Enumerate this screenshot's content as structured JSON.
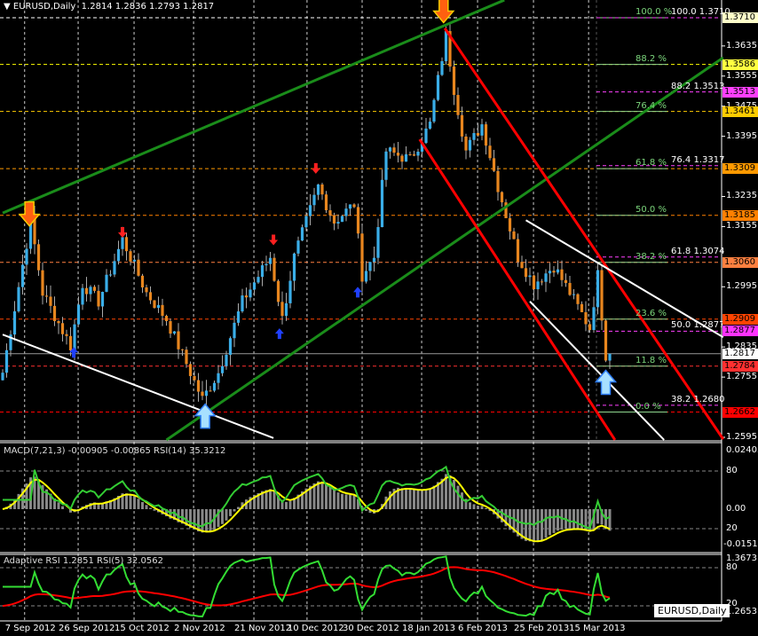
{
  "header": {
    "symbol": "EURUSD,Daily",
    "ohlc": "1.2814 1.2836 1.2793 1.2817"
  },
  "macd_header": "MACD(7,21,3) -0.00905 -0.00865  RSI(14) 35.3212",
  "arsi_header": "Adaptive RSI 1.2851  RSI(5) 32.0562",
  "symbol_badge": "EURUSD,Daily",
  "colors": {
    "bull": "#3aaee8",
    "bear": "#e8861e",
    "channel": "#1a8c1a",
    "red": "#ff0000",
    "white": "#ffffff"
  },
  "chart_data": {
    "type": "candlestick",
    "price_range": [
      1.2595,
      1.371
    ],
    "bar_count": 153,
    "close_anchors": [
      [
        0,
        1.2767
      ],
      [
        7,
        1.3168
      ],
      [
        10,
        1.2979
      ],
      [
        17,
        1.2838
      ],
      [
        20,
        1.3003
      ],
      [
        24,
        1.2956
      ],
      [
        30,
        1.3121
      ],
      [
        36,
        1.2979
      ],
      [
        41,
        1.2909
      ],
      [
        44,
        1.2838
      ],
      [
        50,
        1.2696
      ],
      [
        54,
        1.2767
      ],
      [
        60,
        1.2956
      ],
      [
        67,
        1.3074
      ],
      [
        70,
        1.2909
      ],
      [
        73,
        1.3074
      ],
      [
        79,
        1.3262
      ],
      [
        83,
        1.3168
      ],
      [
        88,
        1.3215
      ],
      [
        90,
        1.3026
      ],
      [
        93,
        1.3074
      ],
      [
        96,
        1.3356
      ],
      [
        102,
        1.3333
      ],
      [
        107,
        1.3427
      ],
      [
        111,
        1.3663
      ],
      [
        113,
        1.3521
      ],
      [
        116,
        1.3356
      ],
      [
        120,
        1.3427
      ],
      [
        124,
        1.3262
      ],
      [
        129,
        1.3074
      ],
      [
        133,
        1.3003
      ],
      [
        138,
        1.305
      ],
      [
        142,
        1.2979
      ],
      [
        147,
        1.2885
      ],
      [
        149,
        1.3026
      ],
      [
        151,
        1.2814
      ],
      [
        152,
        1.2817
      ]
    ],
    "price_ticks": [
      "1.3635",
      "1.3555",
      "1.3475",
      "1.3395",
      "1.3235",
      "1.3155",
      "1.2995",
      "1.2835",
      "1.2755",
      "1.2595"
    ],
    "price_tags": [
      {
        "v": "1.3710",
        "p": 1.371,
        "c": "#ffffc8"
      },
      {
        "v": "1.3586",
        "p": 1.3586,
        "c": "#ffff40"
      },
      {
        "v": "1.3513",
        "p": 1.3513,
        "c": "#ff40ff"
      },
      {
        "v": "1.3461",
        "p": 1.3461,
        "c": "#ffcc00"
      },
      {
        "v": "1.3309",
        "p": 1.3309,
        "c": "#ff9900"
      },
      {
        "v": "1.3185",
        "p": 1.3185,
        "c": "#ff8000"
      },
      {
        "v": "1.3060",
        "p": 1.306,
        "c": "#ff8040"
      },
      {
        "v": "1.2909",
        "p": 1.2909,
        "c": "#ff4400"
      },
      {
        "v": "1.2877",
        "p": 1.2877,
        "c": "#ff33ff"
      },
      {
        "v": "1.2817",
        "p": 1.2817,
        "c": "#ffffff"
      },
      {
        "v": "1.2784",
        "p": 1.2784,
        "c": "#ff3030"
      },
      {
        "v": "1.2662",
        "p": 1.2662,
        "c": "#ff0000"
      }
    ],
    "fib_levels": [
      {
        "label": "100.0  %",
        "p": 1.371,
        "c": "#ffffff"
      },
      {
        "label": "88.2  %",
        "p": 1.3586,
        "c": "#ffff00"
      },
      {
        "label": "76.4  %",
        "p": 1.3461,
        "c": "#ffcc00"
      },
      {
        "label": "61.8  %",
        "p": 1.3309,
        "c": "#ff9900"
      },
      {
        "label": "50.0  %",
        "p": 1.3185,
        "c": "#ff8000"
      },
      {
        "label": "38.2  %",
        "p": 1.306,
        "c": "#ff8040"
      },
      {
        "label": "23.6  %",
        "p": 1.2909,
        "c": "#ff4400"
      },
      {
        "label": "11.8  %",
        "p": 1.2784,
        "c": "#ff3030"
      },
      {
        "label": "0.0  %",
        "p": 1.2662,
        "c": "#ff0000"
      }
    ],
    "fib2_levels": [
      {
        "label": "100.0  1.3710",
        "p": 1.371
      },
      {
        "label": "88.2  1.3513",
        "p": 1.3513
      },
      {
        "label": "76.4  1.3317",
        "p": 1.3317
      },
      {
        "label": "61.8  1.3074",
        "p": 1.3074
      },
      {
        "label": "50.0  1.2877",
        "p": 1.2877
      },
      {
        "label": "38.2  1.2680",
        "p": 1.268
      }
    ],
    "trendlines": [
      {
        "name": "green-channel-upper",
        "c": "#1a8c1a",
        "pts": [
          [
            0,
            1.3191
          ],
          [
            125.6,
            1.3757
          ]
        ]
      },
      {
        "name": "green-channel-lower",
        "c": "#1a8c1a",
        "pts": [
          [
            41,
            1.2588
          ],
          [
            180.4,
            1.3604
          ]
        ]
      },
      {
        "name": "red-channel-upper",
        "c": "#ff0000",
        "pts": [
          [
            110.7,
            1.3682
          ],
          [
            180.4,
            1.259
          ]
        ]
      },
      {
        "name": "red-channel-lower",
        "c": "#ff0000",
        "pts": [
          [
            104.4,
            1.3387
          ],
          [
            153.3,
            1.2588
          ]
        ]
      },
      {
        "name": "white-channel-upper",
        "c": "#ffffff",
        "pts": [
          [
            131,
            1.3172
          ],
          [
            180.4,
            1.2861
          ]
        ]
      },
      {
        "name": "white-channel-lower",
        "c": "#ffffff",
        "pts": [
          [
            132,
            1.2956
          ],
          [
            165.6,
            1.2588
          ]
        ]
      },
      {
        "name": "white-support",
        "c": "#ffffff",
        "pts": [
          [
            0,
            1.2868
          ],
          [
            67.8,
            1.2593
          ]
        ]
      }
    ],
    "signals": [
      {
        "type": "big-down",
        "bar": 6.7,
        "p": 1.319
      },
      {
        "type": "big-down",
        "bar": 110.4,
        "p": 1.373
      },
      {
        "type": "down",
        "bar": 30,
        "p": 1.313
      },
      {
        "type": "down",
        "bar": 67.8,
        "p": 1.311
      },
      {
        "type": "down",
        "bar": 78.4,
        "p": 1.33
      },
      {
        "type": "up",
        "bar": 17.8,
        "p": 1.283
      },
      {
        "type": "up",
        "bar": 69.3,
        "p": 1.288
      },
      {
        "type": "up",
        "bar": 88.9,
        "p": 1.299
      },
      {
        "type": "big-up",
        "bar": 50.7,
        "p": 1.265
      },
      {
        "type": "big-up",
        "bar": 151,
        "p": 1.274
      }
    ],
    "date_labels": [
      {
        "t": "7 Sep 2012",
        "bar": 5.5
      },
      {
        "t": "26 Sep 2012",
        "bar": 18.9
      },
      {
        "t": "15 Oct 2012",
        "bar": 32.9
      },
      {
        "t": "2 Nov 2012",
        "bar": 47.8
      },
      {
        "t": "21 Nov 2012",
        "bar": 62.9
      },
      {
        "t": "10 Dec 2012",
        "bar": 76.2
      },
      {
        "t": "30 Dec 2012",
        "bar": 90
      },
      {
        "t": "18 Jan 2013",
        "bar": 104.9
      },
      {
        "t": "6 Feb 2013",
        "bar": 118.9
      },
      {
        "t": "25 Feb 2013",
        "bar": 132.9
      },
      {
        "t": "15 Mar 2013",
        "bar": 146.7
      }
    ],
    "macd_axis": [
      "0.02403",
      "80",
      "0.00",
      "20",
      "-0.01514"
    ],
    "arsi_axis": [
      "1.3673",
      "80",
      "20",
      "1.2653"
    ]
  }
}
